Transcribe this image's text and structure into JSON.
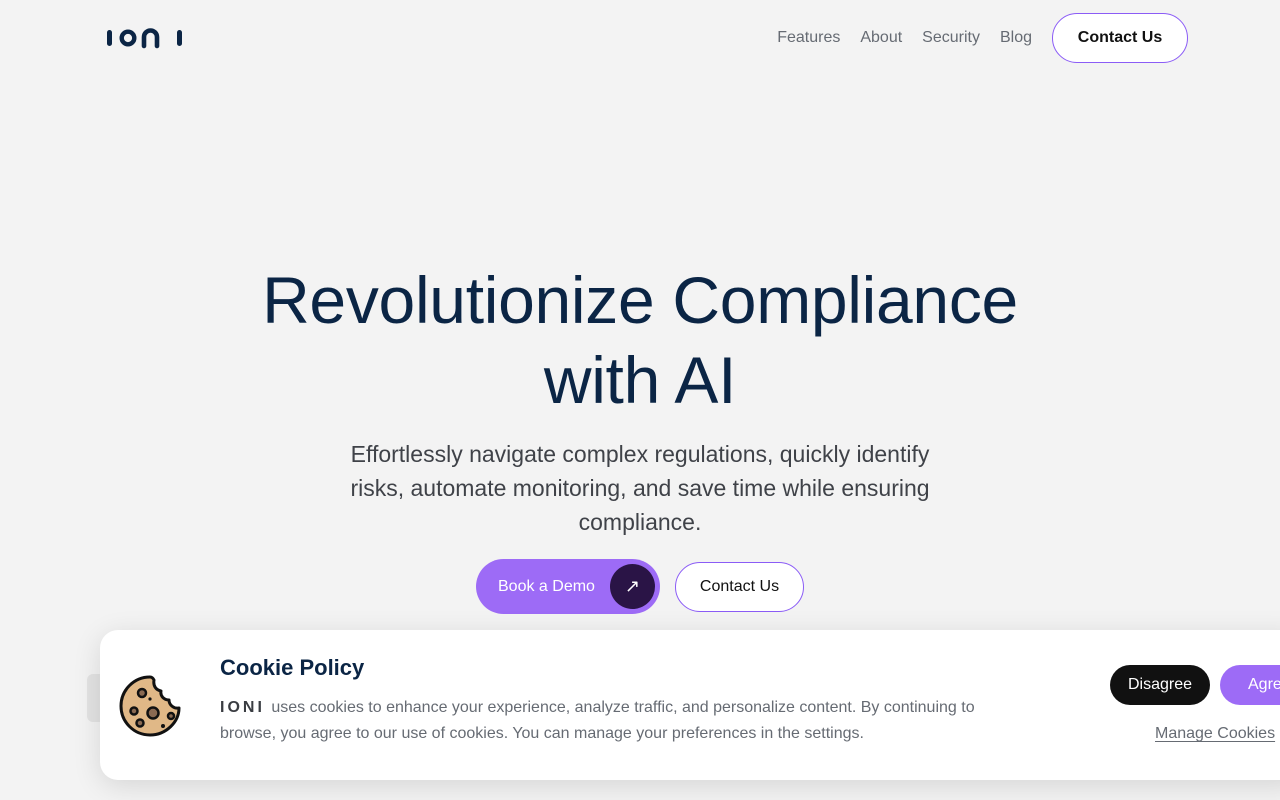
{
  "header": {
    "logo_text": "IONI",
    "nav": [
      "Features",
      "About",
      "Security",
      "Blog"
    ],
    "contact_label": "Contact Us"
  },
  "hero": {
    "title_line1": "Revolutionize Compliance",
    "title_line2": "with AI",
    "subtitle": "Effortlessly navigate complex regulations, quickly identify risks, automate monitoring, and save time while ensuring compliance.",
    "demo_label": "Book a Demo",
    "demo_icon": "arrow-up-right-icon",
    "contact_label": "Contact Us"
  },
  "cookie": {
    "title": "Cookie Policy",
    "brand": "IONI",
    "text": "uses cookies to enhance your experience, analyze traffic, and personalize content. By continuing to browse, you agree to our use of cookies. You can manage your preferences in the settings.",
    "disagree_label": "Disagree",
    "agree_label": "Agree",
    "manage_label": "Manage Cookies",
    "icon": "cookie-icon"
  },
  "colors": {
    "accent": "#9d6bf6",
    "navy": "#0b2545",
    "background": "#f3f3f3",
    "dark_button": "#111111"
  }
}
